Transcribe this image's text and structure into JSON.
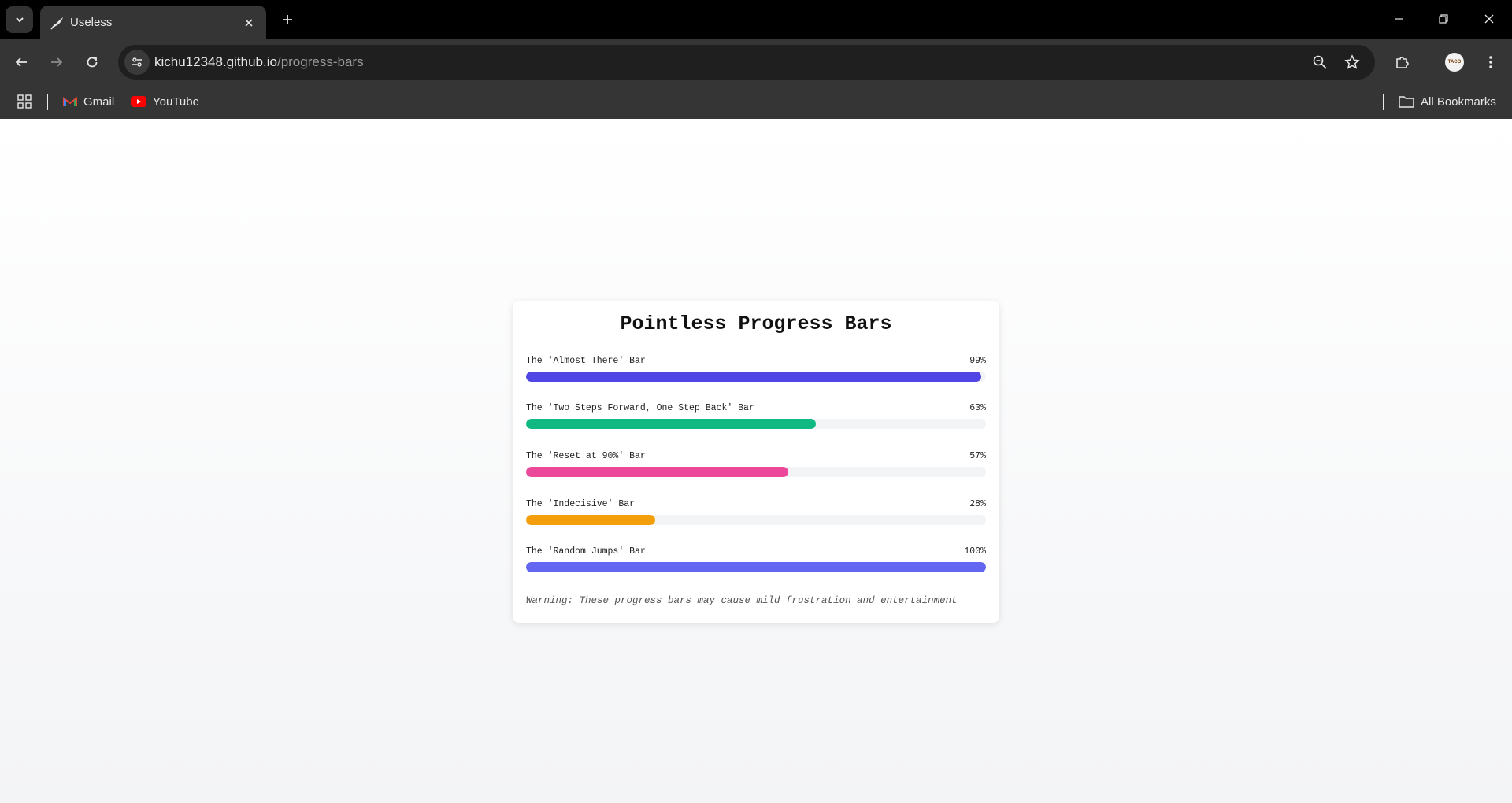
{
  "browser": {
    "tab": {
      "title": "Useless",
      "favicon": "quill-icon"
    },
    "url": {
      "host": "kichu12348.github.io",
      "path": "/progress-bars"
    },
    "bookmarks": [
      {
        "label": "Gmail",
        "icon": "gmail-icon"
      },
      {
        "label": "YouTube",
        "icon": "youtube-icon"
      }
    ],
    "all_bookmarks_label": "All Bookmarks",
    "profile_badge": "TACO"
  },
  "page": {
    "title": "Pointless Progress Bars",
    "bars": [
      {
        "label": "The 'Almost There' Bar",
        "percent_text": "99%",
        "value": 99,
        "color": "#4f46e5"
      },
      {
        "label": "The 'Two Steps Forward, One Step Back' Bar",
        "percent_text": "63%",
        "value": 63,
        "color": "#10b981"
      },
      {
        "label": "The 'Reset at 90%' Bar",
        "percent_text": "57%",
        "value": 57,
        "color": "#ec4899"
      },
      {
        "label": "The 'Indecisive' Bar",
        "percent_text": "28%",
        "value": 28,
        "color": "#f59e0b"
      },
      {
        "label": "The 'Random Jumps' Bar",
        "percent_text": "100%",
        "value": 100,
        "color": "#6366f1"
      }
    ],
    "warning": "Warning: These progress bars may cause mild frustration and entertainment"
  }
}
